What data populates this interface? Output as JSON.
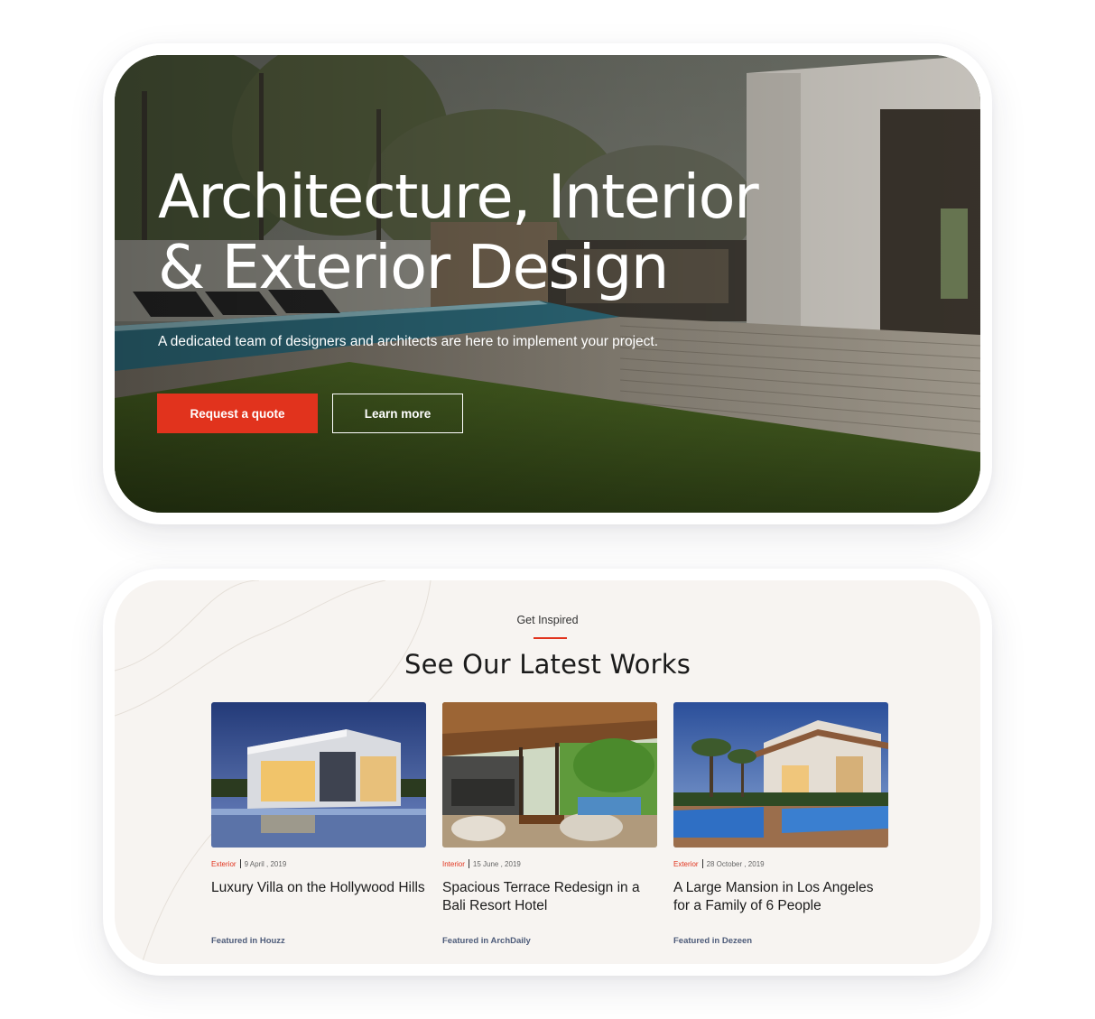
{
  "hero": {
    "title_line1": "Architecture, Interior",
    "title_line2": "& Exterior Design",
    "subtitle": "A dedicated team of designers and architects are here to implement your project.",
    "primary_button": "Request a quote",
    "secondary_button": "Learn more"
  },
  "works": {
    "eyebrow": "Get Inspired",
    "title": "See Our Latest Works",
    "cards": [
      {
        "category": "Exterior",
        "date": "9 April , 2019",
        "title": "Luxury Villa on the Hollywood Hills",
        "featured": "Featured in Houzz"
      },
      {
        "category": "Interior",
        "date": "15 June , 2019",
        "title": "Spacious Terrace Redesign in a Bali Resort Hotel",
        "featured": "Featured in ArchDaily"
      },
      {
        "category": "Exterior",
        "date": "28 October , 2019",
        "title": "A Large Mansion in Los Angeles for a Family of 6 People",
        "featured": "Featured in Dezeen"
      }
    ]
  },
  "colors": {
    "accent": "#e1331d",
    "works_background": "#f7f4f1",
    "featured_text": "#4d5b79"
  }
}
